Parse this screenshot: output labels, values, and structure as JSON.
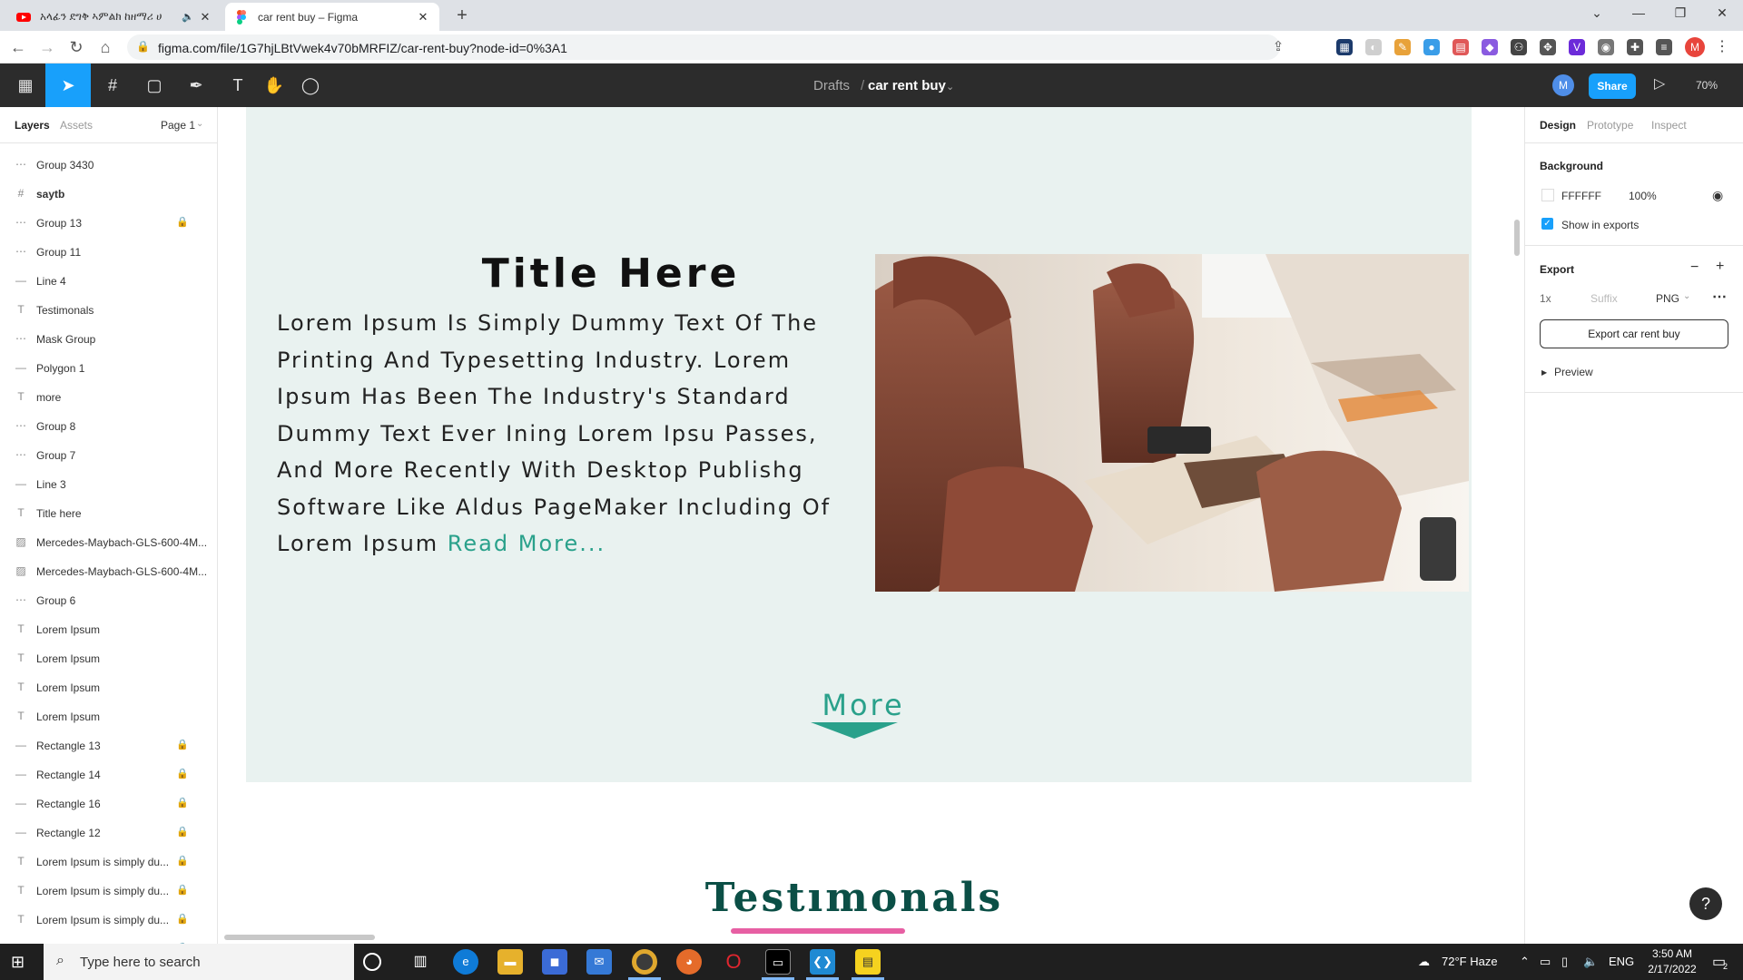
{
  "browser": {
    "tabs": [
      {
        "title": "አላፊን ደግቅ ኣምልክ ከዘማሪ ሀ",
        "active": false
      },
      {
        "title": "car rent buy – Figma",
        "active": true
      }
    ],
    "url": "figma.com/file/1G7hjLBtVwek4v70bMRFIZ/car-rent-buy?node-id=0%3A1",
    "profile_initial": "M"
  },
  "figma": {
    "breadcrumb_parent": "Drafts",
    "breadcrumb_sep": "/",
    "file_name": "car rent buy",
    "avatar_initial": "M",
    "share_label": "Share",
    "zoom": "70%"
  },
  "left_panel": {
    "tabs": [
      "Layers",
      "Assets"
    ],
    "page": "Page 1",
    "layers": [
      {
        "name": "Group 3430",
        "icon": "group",
        "locked": false
      },
      {
        "name": "saytb",
        "icon": "frame",
        "locked": false
      },
      {
        "name": "Group 13",
        "icon": "group",
        "locked": true
      },
      {
        "name": "Group 11",
        "icon": "group",
        "locked": false
      },
      {
        "name": "Line 4",
        "icon": "line",
        "locked": false
      },
      {
        "name": "Testimonals",
        "icon": "text",
        "locked": false
      },
      {
        "name": "Mask Group",
        "icon": "group",
        "locked": false
      },
      {
        "name": "Polygon 1",
        "icon": "line",
        "locked": false
      },
      {
        "name": "more",
        "icon": "text",
        "locked": false
      },
      {
        "name": "Group 8",
        "icon": "group",
        "locked": false
      },
      {
        "name": "Group 7",
        "icon": "group",
        "locked": false
      },
      {
        "name": "Line 3",
        "icon": "line",
        "locked": false
      },
      {
        "name": "Title here",
        "icon": "text",
        "locked": false
      },
      {
        "name": "Mercedes-Maybach-GLS-600-4M...",
        "icon": "image",
        "locked": false
      },
      {
        "name": "Mercedes-Maybach-GLS-600-4M...",
        "icon": "image",
        "locked": false
      },
      {
        "name": "Group 6",
        "icon": "group",
        "locked": false
      },
      {
        "name": "Lorem Ipsum",
        "icon": "text",
        "locked": false
      },
      {
        "name": "Lorem Ipsum",
        "icon": "text",
        "locked": false
      },
      {
        "name": "Lorem Ipsum",
        "icon": "text",
        "locked": false
      },
      {
        "name": "Lorem Ipsum",
        "icon": "text",
        "locked": false
      },
      {
        "name": "Rectangle 13",
        "icon": "line",
        "locked": true
      },
      {
        "name": "Rectangle 14",
        "icon": "line",
        "locked": true
      },
      {
        "name": "Rectangle 16",
        "icon": "line",
        "locked": true
      },
      {
        "name": "Rectangle 12",
        "icon": "line",
        "locked": true
      },
      {
        "name": "Lorem Ipsum is simply du...",
        "icon": "text",
        "locked": true
      },
      {
        "name": "Lorem Ipsum is simply du...",
        "icon": "text",
        "locked": true
      },
      {
        "name": "Lorem Ipsum is simply du...",
        "icon": "text",
        "locked": true
      },
      {
        "name": "Lorem Ipsum is simply du...",
        "icon": "text",
        "locked": true
      }
    ]
  },
  "canvas": {
    "title": "Title Here",
    "body": "Lorem Ipsum Is Simply Dummy  Text Of The Printing  And Typesetting Industry.  Lorem Ipsum Has  Been The Industry's Standard Dummy Text Ever  Ining Lorem Ipsu Passes, And  More  Recently With Desktop Publishg Software Like Aldus PageMaker Including Of Lorem Ipsum",
    "read_more": "Read More...",
    "more_label": "More",
    "testimonials_title": "Testımonals",
    "section_bg": "#e9f2f0",
    "accent": "#2aa18b",
    "testimonials_color": "#0b4f46",
    "underline_color": "#e75fa3"
  },
  "right_panel": {
    "tabs": [
      "Design",
      "Prototype",
      "Inspect"
    ],
    "background_heading": "Background",
    "bg_hex": "FFFFFF",
    "bg_opacity": "100%",
    "show_in_exports": "Show in exports",
    "export_heading": "Export",
    "export_scale": "1x",
    "export_suffix_placeholder": "Suffix",
    "export_format": "PNG",
    "export_button": "Export car rent buy",
    "preview_label": "Preview"
  },
  "taskbar": {
    "search_placeholder": "Type here to search",
    "weather": "72°F  Haze",
    "language": "ENG",
    "time": "3:50 AM",
    "date": "2/17/2022",
    "notification_count": "2"
  }
}
